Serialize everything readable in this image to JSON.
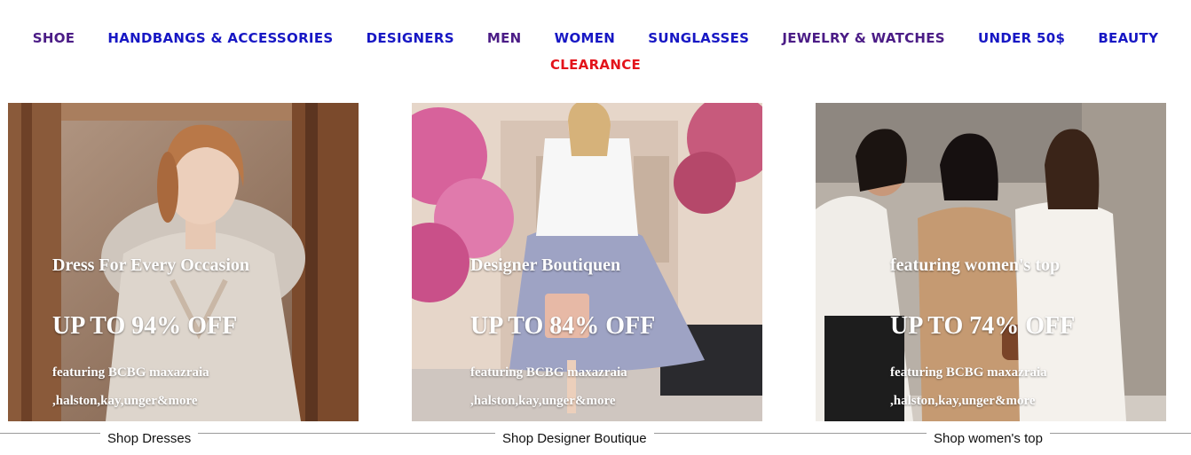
{
  "nav": {
    "items": [
      {
        "label": "SHOE",
        "color": "#4b1c86"
      },
      {
        "label": "HANDBANGS & ACCESSORIES",
        "color": "#1717c4"
      },
      {
        "label": "DESIGNERS",
        "color": "#1717c4"
      },
      {
        "label": "MEN",
        "color": "#4b1c86"
      },
      {
        "label": "WOMEN",
        "color": "#1717c4"
      },
      {
        "label": "SUNGLASSES",
        "color": "#1717c4"
      },
      {
        "label": "JEWELRY & WATCHES",
        "color": "#4b1c86"
      },
      {
        "label": "UNDER 50$",
        "color": "#1717c4"
      },
      {
        "label": "BEAUTY",
        "color": "#1717c4"
      }
    ],
    "clearance": {
      "label": "CLEARANCE",
      "color": "#e3141b"
    }
  },
  "cards": [
    {
      "title": "Dress For Every Occasion",
      "discount": "UP TO 94% OFF",
      "brands_line1": "featuring BCBG maxazraia",
      "brands_line2": ",halston,kay,unger&more",
      "shop_label": "Shop Dresses"
    },
    {
      "title": "Designer Boutiquen",
      "discount": "UP TO 84% OFF",
      "brands_line1": "featuring BCBG maxazraia",
      "brands_line2": ",halston,kay,unger&more",
      "shop_label": "Shop Designer Boutique"
    },
    {
      "title": "featuring women's top",
      "discount": "UP TO 74% OFF",
      "brands_line1": "featuring BCBG maxazraia",
      "brands_line2": ",halston,kay,unger&more",
      "shop_label": "Shop women's top"
    }
  ]
}
